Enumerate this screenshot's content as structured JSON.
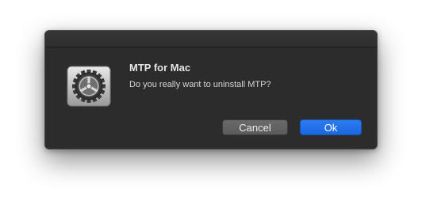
{
  "dialog": {
    "title": "MTP for Mac",
    "message": "Do you really want to uninstall MTP?",
    "icon": "system-preferences-gear-icon"
  },
  "buttons": {
    "cancel_label": "Cancel",
    "ok_label": "Ok"
  },
  "colors": {
    "dialog_background": "#2c2c2c",
    "accent": "#1a68e0"
  }
}
